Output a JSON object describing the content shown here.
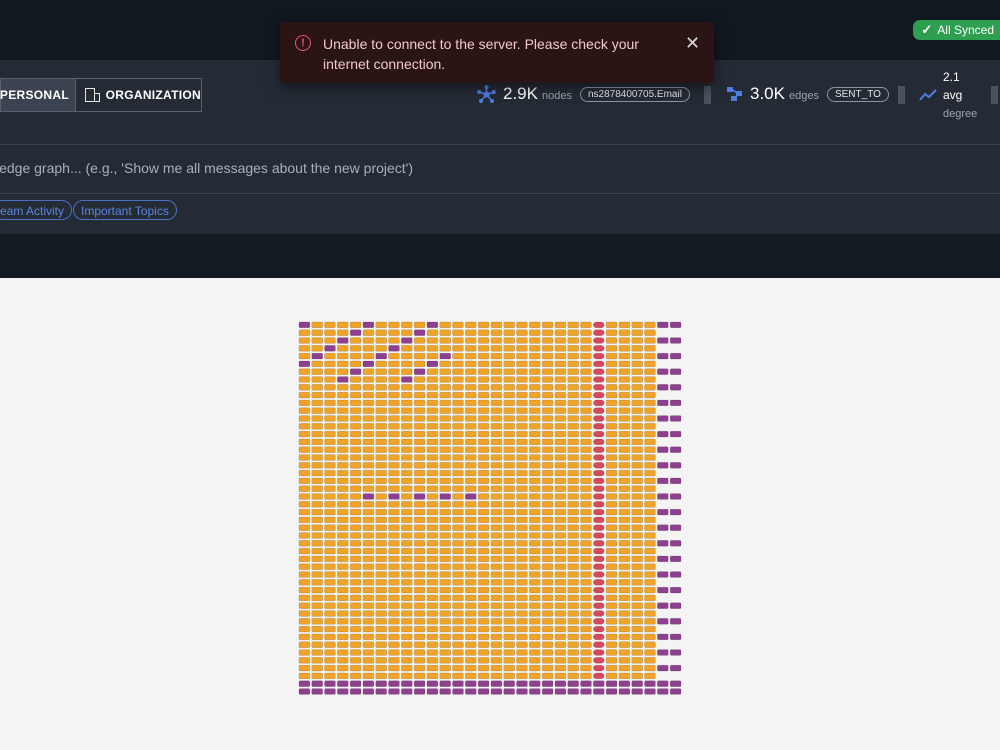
{
  "status": {
    "synced_label": "All Synced"
  },
  "toast": {
    "message": "Unable to connect to the server. Please check your internet connection."
  },
  "scope": {
    "personal_label": "PERSONAL",
    "organization_label": "ORGANIZATION",
    "active": "personal"
  },
  "stats": {
    "nodes": {
      "value": "2.9K",
      "unit": "nodes",
      "badge": "ns2878400705.Email"
    },
    "edges": {
      "value": "3.0K",
      "unit": "edges",
      "badge": "SENT_TO"
    },
    "degree": {
      "value": "2.1",
      "line2": "avg",
      "label": "degree"
    }
  },
  "search": {
    "placeholder": "ledge graph... (e.g., 'Show me all messages about the new project')"
  },
  "suggestions": [
    "eam Activity",
    "Important Topics"
  ],
  "colors": {
    "accent": "#4a70c4",
    "email_node": "#f0a427",
    "sent_to_node": "#8e3f8e",
    "highlight_node": "#d6485d"
  },
  "icons": [
    "check-icon",
    "error-icon",
    "close-icon",
    "building-icon",
    "graph-nodes-icon",
    "edges-icon",
    "trend-icon"
  ]
}
